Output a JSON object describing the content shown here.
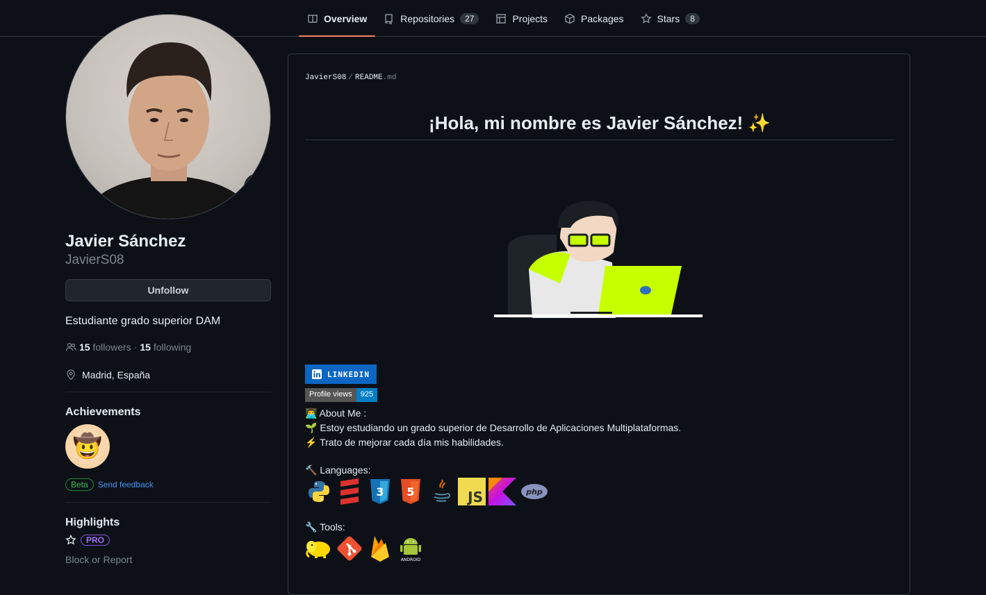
{
  "nav": {
    "tabs": [
      {
        "label": "Overview",
        "count": null,
        "active": true
      },
      {
        "label": "Repositories",
        "count": "27"
      },
      {
        "label": "Projects",
        "count": null
      },
      {
        "label": "Packages",
        "count": null
      },
      {
        "label": "Stars",
        "count": "8"
      }
    ]
  },
  "profile": {
    "full_name": "Javier Sánchez",
    "username": "JavierS08",
    "status_emoji": "🎯",
    "unfollow_label": "Unfollow",
    "bio": "Estudiante grado superior DAM",
    "followers_count": "15",
    "followers_label": "followers",
    "following_count": "15",
    "following_label": "following",
    "separator": "·",
    "location": "Madrid, España"
  },
  "achievements": {
    "title": "Achievements",
    "badge_emoji": "🤠",
    "beta_label": "Beta",
    "feedback_label": "Send feedback"
  },
  "highlights": {
    "title": "Highlights",
    "pro_label": "PRO",
    "block_label": "Block or Report"
  },
  "readme": {
    "crumb_user": "JavierS08",
    "crumb_sep": "/",
    "crumb_file": "README",
    "crumb_ext": ".md",
    "headline": "¡Hola, mi nombre es Javier Sánchez!",
    "headline_emoji": "✨",
    "linkedin_label": "LINKEDIN",
    "views_label": "Profile views",
    "views_count": "925",
    "about_title": "👨‍💻 About Me :",
    "about_line1": "🌱 Estoy estudiando un grado superior de Desarrollo de Aplicaciones Multiplataformas.",
    "about_line2": "⚡ Trato de mejorar cada día mis habilidades.",
    "languages_title": "🔨 Languages:",
    "languages": [
      "python-icon",
      "scala-icon",
      "css3-icon",
      "html5-icon",
      "java-icon",
      "javascript-icon",
      "kotlin-icon",
      "php-icon"
    ],
    "js_text": "JS",
    "php_text": "php",
    "tools_title": "🔧 Tools:",
    "tools": [
      "hadoop-icon",
      "git-icon",
      "firebase-icon",
      "android-icon"
    ],
    "android_text": "ANDROID"
  },
  "colors": {
    "accent_tab": "#f78166",
    "link": "#4493f8",
    "linkedin": "#0a66c2",
    "illustration_lime": "#c6ff00"
  }
}
